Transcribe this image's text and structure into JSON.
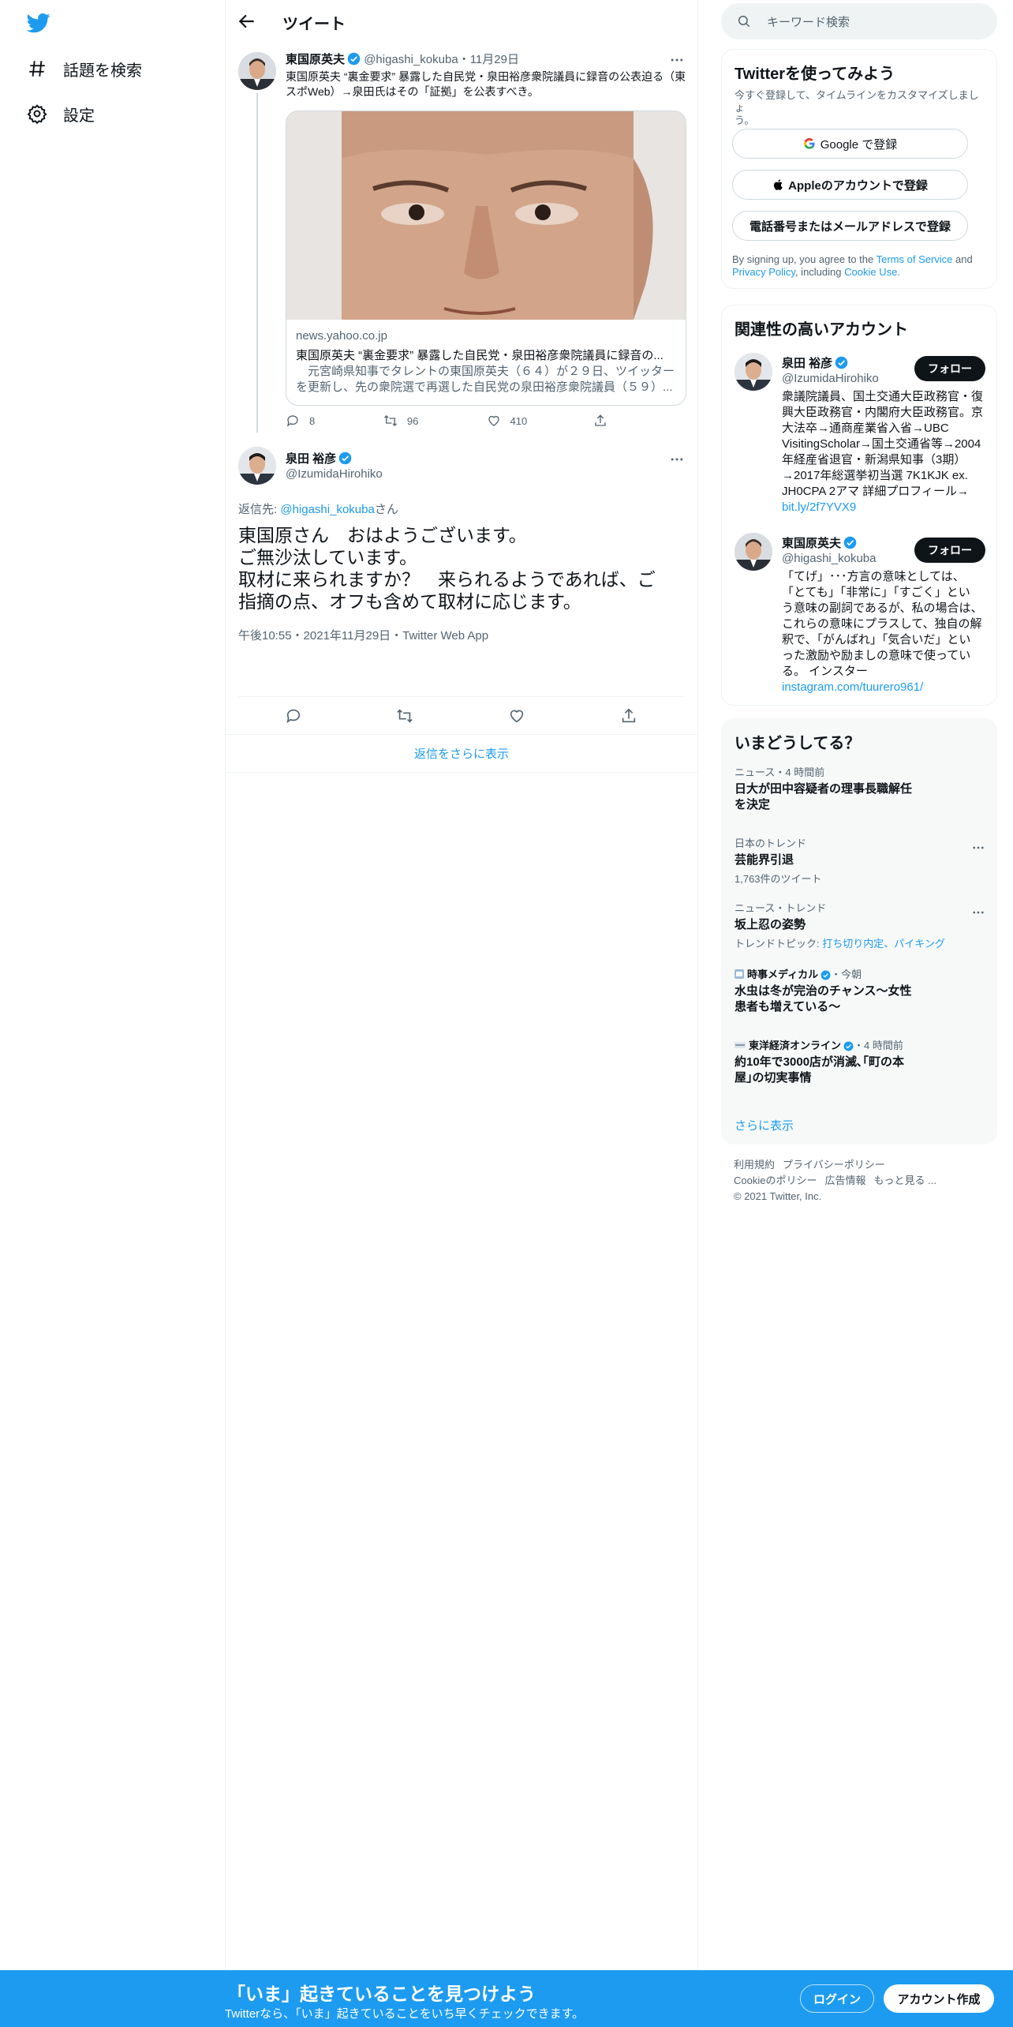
{
  "nav": {
    "items": [
      {
        "label": "話題を検索",
        "icon": "hashtag-icon"
      },
      {
        "label": "設定",
        "icon": "gear-icon"
      }
    ]
  },
  "header": {
    "title": "ツイート"
  },
  "quoted_tweet": {
    "name": "東国原英夫",
    "handle": "@higashi_kokuba",
    "date": "11月29日",
    "text": "東国原英夫 “裏金要求” 暴露した自民党・泉田裕彦衆院議員に録音の公表迫る（東スポWeb）→泉田氏はその「証拠」を公表すべき。",
    "card": {
      "domain": "news.yahoo.co.jp",
      "title": "東国原英夫 “裏金要求” 暴露した自民党・泉田裕彦衆院議員に録音の...",
      "desc": "　元宮崎県知事でタレントの東国原英夫（６４）が２９日、ツイッターを更新し、先の衆院選で再選した自民党の泉田裕彦衆院議員（５９）..."
    },
    "stats": {
      "replies": "8",
      "retweets": "96",
      "likes": "410"
    }
  },
  "main_tweet": {
    "name": "泉田 裕彦",
    "handle": "@IzumidaHirohiko",
    "reply_prefix": "返信先: ",
    "reply_to": "@higashi_kokuba",
    "reply_suffix": "さん",
    "lines": [
      "東国原さん　おはようございます。",
      "ご無沙汰しています。",
      "取材に来られますか？　来られるようであれば、ご",
      "指摘の点、オフも含めて取材に応じます。"
    ],
    "meta": "午後10:55・2021年11月29日・Twitter Web App"
  },
  "show_more_replies": "返信をさらに表示",
  "search": {
    "placeholder": "キーワード検索"
  },
  "signup_panel": {
    "title": "Twitterを使ってみよう",
    "subtitle_lines": [
      "今すぐ登録して、タイムラインをカスタマイズしましょ",
      "う。"
    ],
    "google": "Google で登録",
    "apple": "Appleのアカウントで登録",
    "phone": "電話番号またはメールアドレスで登録",
    "terms_line1_a": "By signing up, you agree to the ",
    "terms_link1": "Terms of Service",
    "terms_line1_b": " and",
    "terms_link2": "Privacy Policy",
    "terms_line2_a": ", including ",
    "terms_link3": "Cookie Use",
    "terms_line2_b": "."
  },
  "related": {
    "title": "関連性の高いアカウント",
    "follow_label": "フォロー",
    "accounts": [
      {
        "name": "泉田 裕彦",
        "handle": "@IzumidaHirohiko",
        "bio_lines": [
          "衆議院議員、国土交通大臣政務官・復",
          "興大臣政務官・内閣府大臣政務官。京",
          "大法卒→通商産業省入省→UBC",
          "VisitingScholar→国土交通省等→2004",
          "年経産省退官・新潟県知事（3期）",
          "→2017年総選挙初当選 7K1KJK ex.",
          "JH0CPA 2アマ 詳細プロフィール→"
        ],
        "link": "bit.ly/2f7YVX9"
      },
      {
        "name": "東国原英夫",
        "handle": "@higashi_kokuba",
        "bio_lines": [
          "「てげ」･･･方言の意味としては、",
          "「とても」「非常に」「すごく」とい",
          "う意味の副詞であるが、私の場合は、",
          "これらの意味にプラスして、独自の解",
          "釈で、「がんばれ」「気合いだ」とい",
          "った激励や励ましの意味で使ってい",
          "る。 インスター"
        ],
        "link": "instagram.com/tuurero961/"
      }
    ]
  },
  "trends": {
    "title": "いまどうしてる？",
    "items": [
      {
        "meta": "ニュース・4 時間前",
        "title_lines": [
          "日大が田中容疑者の理事長職解任",
          "を決定"
        ],
        "sub": "",
        "more": false
      },
      {
        "meta": "日本のトレンド",
        "title_lines": [
          "芸能界引退"
        ],
        "sub": "1,763件のツイート",
        "more": true
      },
      {
        "meta": "ニュース・トレンド",
        "title_lines": [
          "坂上忍の姿勢"
        ],
        "sub_prefix": "トレンドトピック: ",
        "sub_links": "打ち切り内定、パイキング",
        "more": true
      },
      {
        "meta_source": "時事メディカル",
        "meta_time": "・今朝",
        "title_lines": [
          "水虫は冬が完治のチャンス～女性",
          "患者も増えている～"
        ],
        "more": false
      },
      {
        "meta_source": "東洋経済オンライン",
        "meta_time": "・4 時間前",
        "title_lines": [
          "約10年で3000店が消滅､｢町の本",
          "屋｣の切実事情"
        ],
        "more": false
      }
    ],
    "show_more": "さらに表示"
  },
  "footer": {
    "links1": [
      "利用規約",
      "プライバシーポリシー"
    ],
    "links2": [
      "Cookieのポリシー",
      "広告情報",
      "もっと見る ..."
    ],
    "copyright": "© 2021 Twitter, Inc."
  },
  "bottom_bar": {
    "title": "「いま」起きていることを見つけよう",
    "subtitle": "Twitterなら、「いま」起きていることをいち早くチェックできます。",
    "login": "ログイン",
    "signup": "アカウント作成"
  },
  "colors": {
    "accent": "#1d9bf0",
    "text": "#0f1419",
    "muted": "#536471",
    "border": "#eff3f4"
  }
}
